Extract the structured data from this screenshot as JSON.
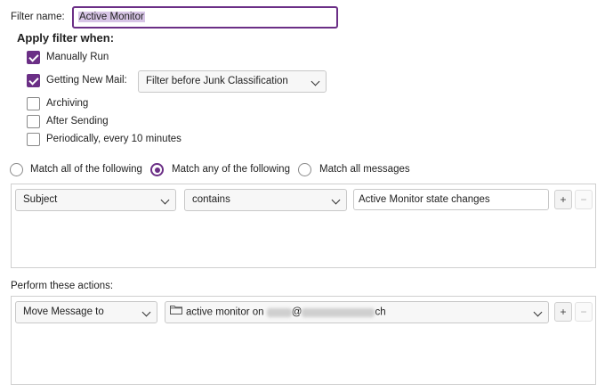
{
  "filter_name": {
    "label": "Filter name:",
    "value": "Active Monitor"
  },
  "apply_when": {
    "heading": "Apply filter when:",
    "manually_run": {
      "label": "Manually Run",
      "checked": true
    },
    "getting_new_mail": {
      "label": "Getting New Mail:",
      "checked": true,
      "option": "Filter before Junk Classification"
    },
    "archiving": {
      "label": "Archiving",
      "checked": false
    },
    "after_sending": {
      "label": "After Sending",
      "checked": false
    },
    "periodically": {
      "label": "Periodically, every 10 minutes",
      "checked": false
    }
  },
  "match": {
    "all": {
      "label": "Match all of the following",
      "selected": false
    },
    "any": {
      "label": "Match any of the following",
      "selected": true
    },
    "all_messages": {
      "label": "Match all messages",
      "selected": false
    }
  },
  "rule": {
    "field": "Subject",
    "operator": "contains",
    "value": "Active Monitor state changes",
    "add_label": "+",
    "remove_label": "−"
  },
  "actions": {
    "heading": "Perform these actions:",
    "action": "Move Message to",
    "target_prefix": "active monitor on",
    "target_at": "@",
    "target_suffix": "ch",
    "add_label": "+",
    "remove_label": "−"
  },
  "colors": {
    "accent": "#6b2f86",
    "selection": "#d7c5e6"
  }
}
